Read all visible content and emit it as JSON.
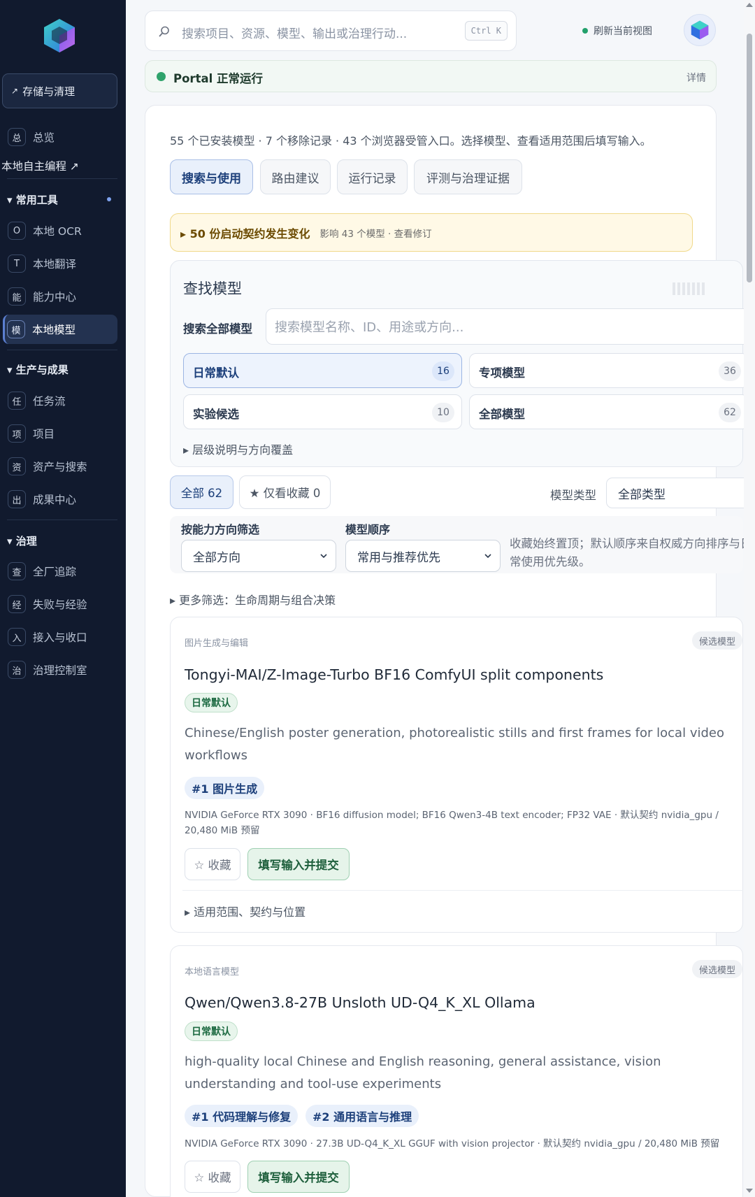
{
  "sidebar": {
    "storage_label": "存储与清理",
    "overview": {
      "glyph": "总",
      "label": "总览"
    },
    "local_dev_label": "本地自主编程 ↗",
    "common_tools": {
      "title": "▾ 常用工具",
      "items": [
        {
          "glyph": "O",
          "label": "本地 OCR"
        },
        {
          "glyph": "T",
          "label": "本地翻译"
        },
        {
          "glyph": "能",
          "label": "能力中心"
        },
        {
          "glyph": "模",
          "label": "本地模型"
        }
      ]
    },
    "production": {
      "title": "▾ 生产与成果",
      "items": [
        {
          "glyph": "任",
          "label": "任务流"
        },
        {
          "glyph": "项",
          "label": "项目"
        },
        {
          "glyph": "资",
          "label": "资产与搜索"
        },
        {
          "glyph": "出",
          "label": "成果中心"
        }
      ]
    },
    "governance": {
      "title": "▾ 治理",
      "items": [
        {
          "glyph": "查",
          "label": "全厂追踪"
        },
        {
          "glyph": "经",
          "label": "失败与经验"
        },
        {
          "glyph": "入",
          "label": "接入与收口"
        },
        {
          "glyph": "治",
          "label": "治理控制室"
        }
      ]
    }
  },
  "topbar": {
    "search_placeholder": "搜索项目、资源、模型、输出或治理行动...",
    "shortcut": "Ctrl K",
    "refresh_label": "刷新当前视图"
  },
  "status": {
    "text": "Portal 正常运行",
    "detail": "详情"
  },
  "summary": "55 个已安装模型 · 7 个移除记录 · 43 个浏览器受管入口。选择模型、查看适用范围后填写输入。",
  "tabs": [
    "搜索与使用",
    "路由建议",
    "运行记录",
    "评测与治理证据"
  ],
  "notice": {
    "title": "▸ 50 份启动契约发生变化",
    "sub": "影响 43 个模型 · 查看修订"
  },
  "finder": {
    "title": "查找模型",
    "search_label": "搜索全部模型",
    "search_placeholder": "搜索模型名称、ID、用途或方向...",
    "tiers": [
      {
        "label": "日常默认",
        "count": "16"
      },
      {
        "label": "专项模型",
        "count": "36"
      },
      {
        "label": "实验候选",
        "count": "10"
      },
      {
        "label": "全部模型",
        "count": "62"
      }
    ],
    "tier_expander": "▸ 层级说明与方向覆盖"
  },
  "filters": {
    "all_chip": "全部 62",
    "fav_chip": "★ 仅看收藏 0",
    "type_label": "模型类型",
    "type_value": "全部类型",
    "direction_label": "按能力方向筛选",
    "direction_value": "全部方向",
    "order_label": "模型顺序",
    "order_value": "常用与推荐优先",
    "note": "收藏始终置顶；默认顺序来自权威方向排序与日常使用优先级。",
    "more": "▸ 更多筛选：生命周期与组合决策"
  },
  "models": [
    {
      "category": "图片生成与编辑",
      "badge": "候选模型",
      "title": "Tongyi-MAI/Z-Image-Turbo BF16 ComfyUI split components",
      "tier": "日常默认",
      "description": "Chinese/English poster generation, photorealistic stills and first frames for local video workflows",
      "tags": [
        "#1 图片生成"
      ],
      "hardware": "NVIDIA GeForce RTX 3090 · BF16 diffusion model; BF16 Qwen3-4B text encoder; FP32 VAE · 默认契约 nvidia_gpu / 20,480 MiB 预留",
      "fav_label": "☆ 收藏",
      "fill_label": "填写输入并提交",
      "scope": "▸ 适用范围、契约与位置"
    },
    {
      "category": "本地语言模型",
      "badge": "候选模型",
      "title": "Qwen/Qwen3.8-27B Unsloth UD-Q4_K_XL Ollama",
      "tier": "日常默认",
      "description": "high-quality local Chinese and English reasoning, general assistance, vision understanding and tool-use experiments",
      "tags": [
        "#1 代码理解与修复",
        "#2 通用语言与推理"
      ],
      "hardware": "NVIDIA GeForce RTX 3090 · 27.3B UD-Q4_K_XL GGUF with vision projector · 默认契约 nvidia_gpu / 20,480 MiB 预留",
      "fav_label": "☆ 收藏",
      "fill_label": "填写输入并提交"
    }
  ],
  "colors": {
    "sidebar": "#111a2e",
    "accent": "#1c3f7a",
    "success": "#2fa36b",
    "warning_bg": "#fff9e6"
  }
}
